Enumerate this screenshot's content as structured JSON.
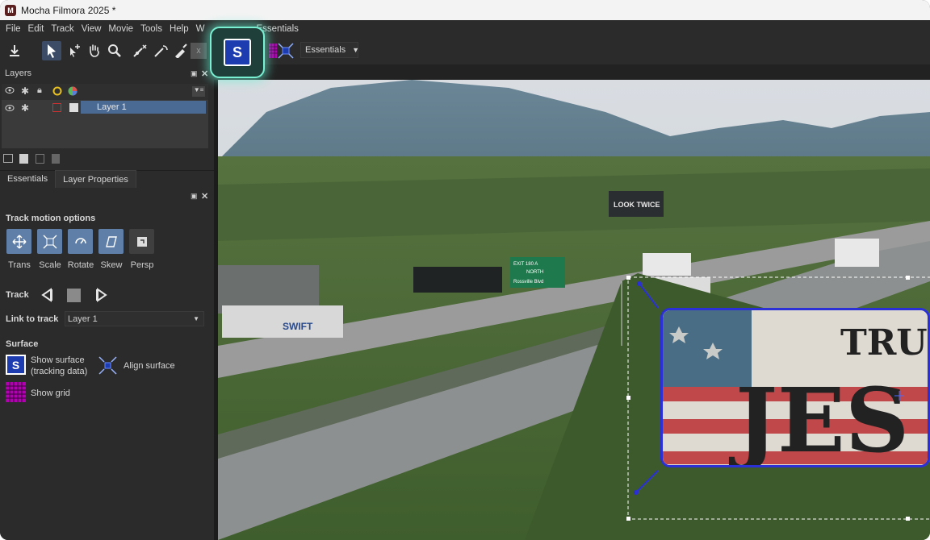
{
  "window": {
    "title": "Mocha Filmora 2025 *",
    "app_icon": "M"
  },
  "menu": [
    "File",
    "Edit",
    "Track",
    "View",
    "Movie",
    "Tools",
    "Help",
    "W",
    "Essentials"
  ],
  "toolbar": {
    "workspace_dropdown": "Essentials",
    "highlighted_icon": "S"
  },
  "layers_panel": {
    "title": "Layers",
    "layer_name": "Layer 1"
  },
  "tabs": [
    "Essentials",
    "Layer Properties"
  ],
  "track_motion": {
    "title": "Track motion options",
    "buttons": [
      "Trans",
      "Scale",
      "Rotate",
      "Skew",
      "Persp"
    ]
  },
  "track": {
    "label": "Track"
  },
  "link_to_track": {
    "label": "Link to track",
    "value": "Layer 1"
  },
  "surface": {
    "title": "Surface",
    "show_surface": "Show surface\n(tracking data)",
    "align_surface": "Align surface",
    "show_grid": "Show grid"
  },
  "scene_text": {
    "sign_look": "LOOK TWICE",
    "truck": "SWIFT",
    "highway_sign_line1": "Rossville Blvd",
    "billboard_word1": "TRU",
    "billboard_word2": "JES",
    "highway_exit": "EXIT 180 A",
    "north": "NORTH"
  },
  "colors": {
    "accent_highlight": "#7af0d2",
    "selection": "#4a6a93",
    "surface_blue": "#1c3cb0",
    "grid_magenta": "#b000b0"
  }
}
